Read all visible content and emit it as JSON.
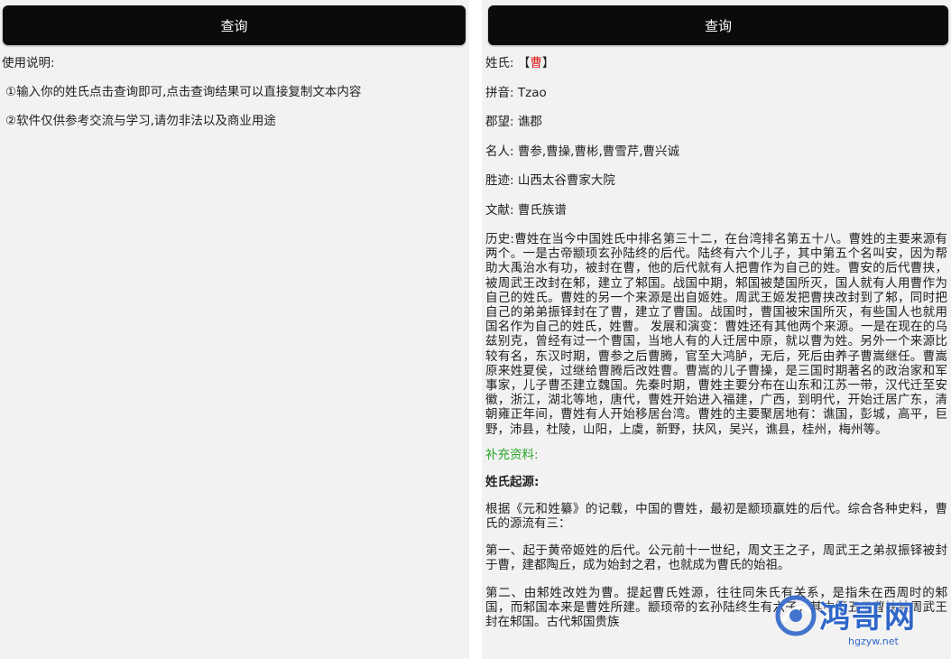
{
  "left": {
    "query_button": "查询",
    "usage_title": "使用说明:",
    "usage_items": [
      "①输入你的姓氏点击查询即可,点击查询结果可以直接复制文本内容",
      "②软件仅供参考交流与学习,请勿非法以及商业用途"
    ]
  },
  "right": {
    "query_button": "查询",
    "surname_label": "姓氏:",
    "surname_open": "【",
    "surname_value": "曹",
    "surname_close": "】",
    "pinyin_label": "拼音:",
    "pinyin_value": "Tzao",
    "junwang_label": "郡望:",
    "junwang_value": "谯郡",
    "famous_label": "名人:",
    "famous_value": "曹参,曹操,曹彬,曹雪芹,曹兴诚",
    "sites_label": "胜迹:",
    "sites_value": "山西太谷曹家大院",
    "docs_label": "文献:",
    "docs_value": "曹氏族谱",
    "history_label": "历史:",
    "history_value": "曹姓在当今中国姓氏中排名第三十二，在台湾排名第五十八。曹姓的主要来源有两个。一是古帝颛顼玄孙陆终的后代。陆终有六个儿子，其中第五个名叫安，因为帮助大禹治水有功，被封在曹，他的后代就有人把曹作为自己的姓。曹安的后代曹挟，被周武王改封在邾，建立了邾国。战国中期，邾国被楚国所灭，国人就有人用曹作为自己的姓氏。曹姓的另一个来源是出自姬姓。周武王姬发把曹挟改封到了邾，同时把自己的弟弟振铎封在了曹，建立了曹国。战国时，曹国被宋国所灭，有些国人也就用国名作为自己的姓氏，姓曹。 发展和演变：曹姓还有其他两个来源。一是在现在的乌兹别克，曾经有过一个曹国，当地人有的人迁居中原，就以曹为姓。另外一个来源比较有名，东汉时期，曹参之后曹腾，官至大鸿胪，无后，死后由养子曹嵩继任。曹嵩原来姓夏侯，过继给曹腾后改姓曹。曹嵩的儿子曹操，是三国时期著名的政治家和军事家，儿子曹丕建立魏国。先秦时期，曹姓主要分布在山东和江苏一带，汉代迁至安徽，浙江，湖北等地，唐代，曹姓开始进入福建，广西，到明代，开始迁居广东，清朝雍正年间，曹姓有人开始移居台湾。曹姓的主要聚居地有：谯国，彭城，高平，巨野，沛县，杜陵，山阳，上虞，新野，扶风，吴兴，谯县，桂州，梅州等。",
    "supplement_title": "补充资料:",
    "origin_title": "姓氏起源:",
    "paragraphs": [
      "根据《元和姓纂》的记载，中国的曹姓，最初是颛顼嬴姓的后代。综合各种史料，曹氏的源流有三：",
      "第一、起于黄帝姬姓的后代。公元前十一世纪，周文王之子，周武王之弟叔振铎被封于曹，建都陶丘，成为始封之君，也就成为曹氏的始祖。",
      "第二、由邾姓改姓为曹。提起曹氏姓源，往往同朱氏有关系，是指朱在西周时的邾国，而邾国本来是曹姓所建。颛顼帝的玄孙陆终生有六子，其中第五子曹挟被周武王封在邾国。古代邾国贵族"
    ]
  },
  "watermark": {
    "text": "鸿哥网",
    "url": "hgzyw.net"
  },
  "colors": {
    "button_bg": "#0b0b0b",
    "screen_bg": "#f2f2f2",
    "surname_highlight": "#d91b1b",
    "supplement_green": "#2aa52a",
    "watermark_blue": "#2f66c9"
  }
}
